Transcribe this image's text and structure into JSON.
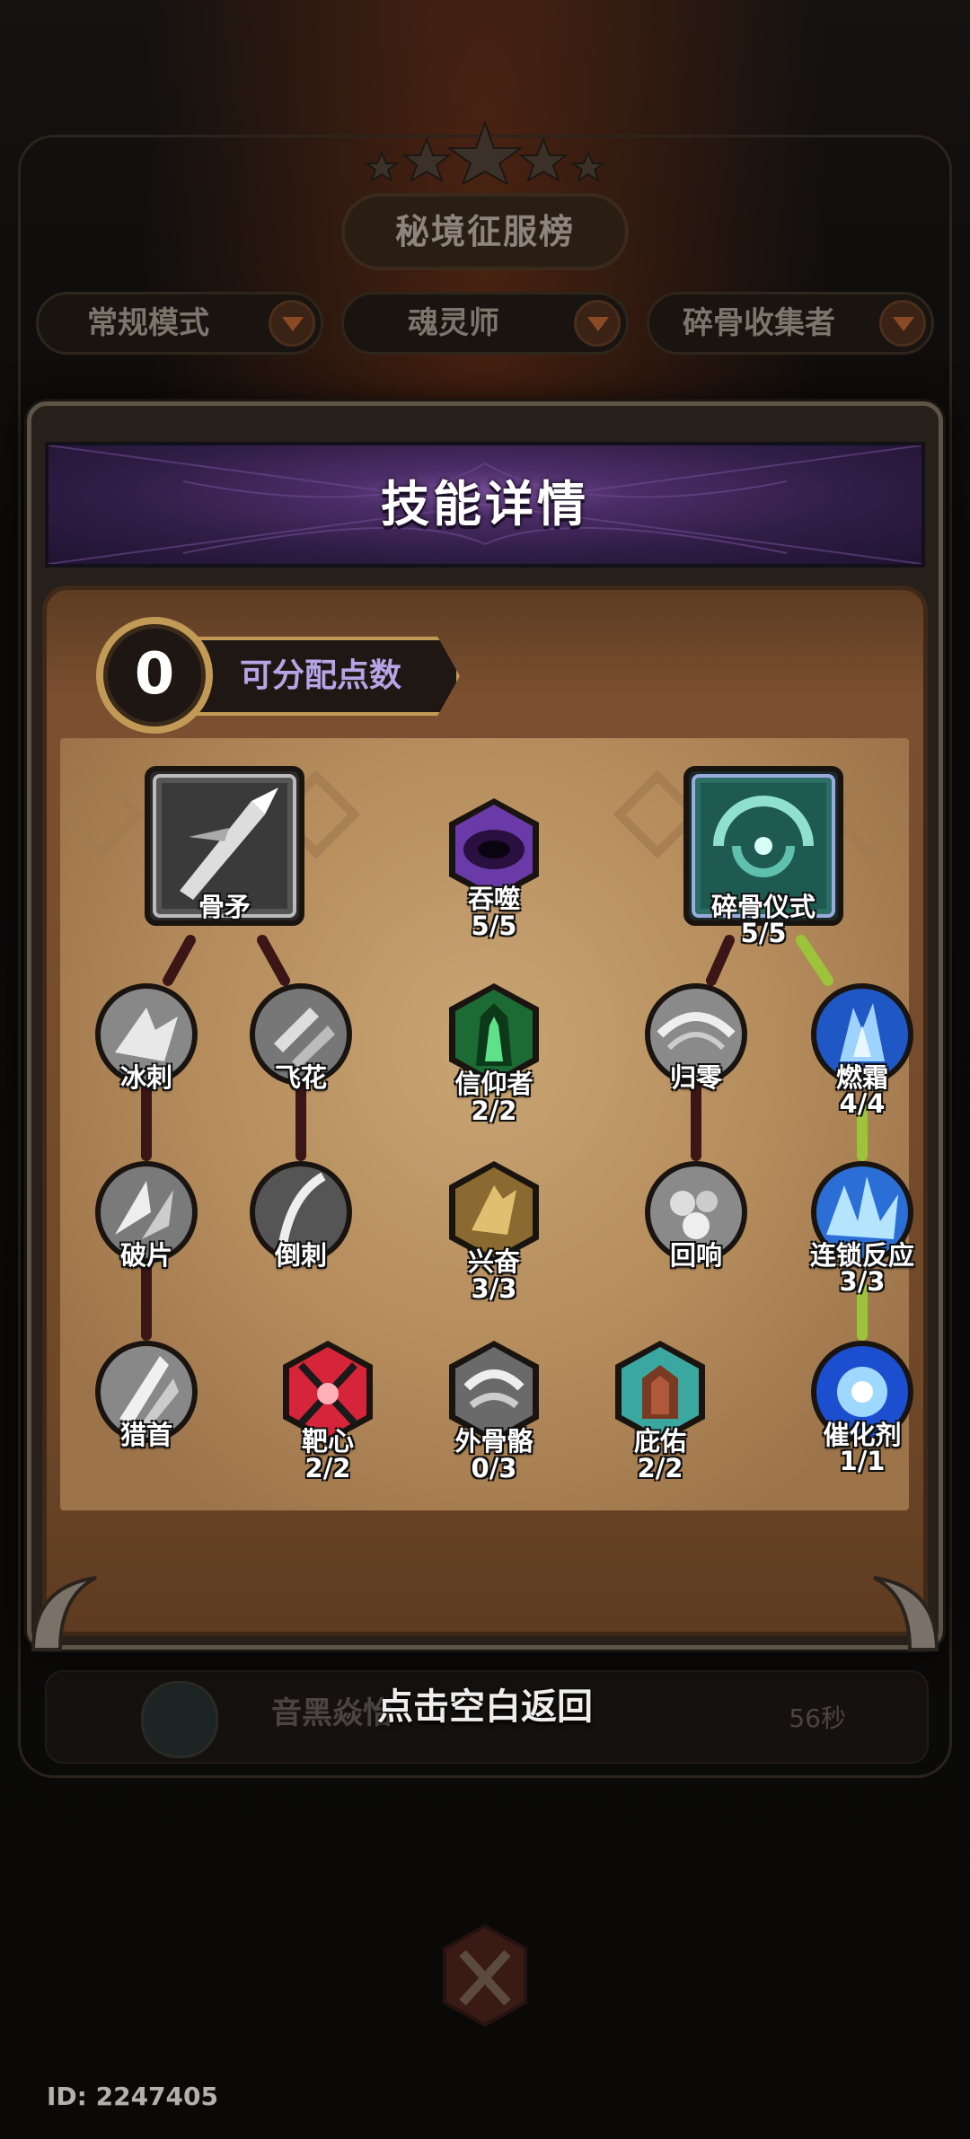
{
  "background": {
    "board_title": "秘境征服榜",
    "filters": [
      "常规模式",
      "魂灵师",
      "碎骨收集者"
    ],
    "row_name": "音黑焱怡",
    "row_time": "56秒",
    "id_label": "ID: 2247405"
  },
  "modal": {
    "title": "技能详情",
    "points_value": "0",
    "points_label": "可分配点数"
  },
  "skills": {
    "gumao": {
      "label": "骨矛"
    },
    "tunshi": {
      "label": "吞噬",
      "count": "5/5"
    },
    "suigu": {
      "label": "碎骨仪式",
      "count": "5/5"
    },
    "bingci": {
      "label": "冰刺"
    },
    "feihua": {
      "label": "飞花"
    },
    "xinyang": {
      "label": "信仰者",
      "count": "2/2"
    },
    "guiling": {
      "label": "归零"
    },
    "ranshuang": {
      "label": "燃霜",
      "count": "4/4"
    },
    "popian": {
      "label": "破片"
    },
    "daoci": {
      "label": "倒刺"
    },
    "xingfen": {
      "label": "兴奋",
      "count": "3/3"
    },
    "huixiang": {
      "label": "回响"
    },
    "liansuo": {
      "label": "连锁反应",
      "count": "3/3"
    },
    "lieshou": {
      "label": "猎首"
    },
    "baxin": {
      "label": "靶心",
      "count": "2/2"
    },
    "waigu": {
      "label": "外骨骼",
      "count": "0/3"
    },
    "biyou": {
      "label": "庇佑",
      "count": "2/2"
    },
    "cuihua": {
      "label": "催化剂",
      "count": "1/1"
    }
  },
  "hint": "点击空白返回"
}
